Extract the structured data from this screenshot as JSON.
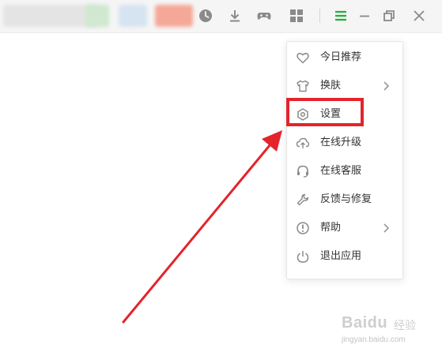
{
  "titlebar": {
    "icons": [
      "history-icon",
      "download-icon",
      "game-icon",
      "apps-icon",
      "menu-icon",
      "minimize-icon",
      "restore-icon",
      "close-icon"
    ],
    "menu_active_color": "#1fb03a"
  },
  "menu": {
    "items": [
      {
        "label": "今日推荐",
        "icon": "heart-icon",
        "has_submenu": false
      },
      {
        "label": "换肤",
        "icon": "shirt-icon",
        "has_submenu": true
      },
      {
        "label": "设置",
        "icon": "settings-icon",
        "has_submenu": false,
        "highlighted": true
      },
      {
        "label": "在线升级",
        "icon": "cloud-upload-icon",
        "has_submenu": false
      },
      {
        "label": "在线客服",
        "icon": "headset-icon",
        "has_submenu": false
      },
      {
        "label": "反馈与修复",
        "icon": "wrench-icon",
        "has_submenu": false
      },
      {
        "label": "帮助",
        "icon": "help-icon",
        "has_submenu": true
      },
      {
        "label": "退出应用",
        "icon": "power-icon",
        "has_submenu": false
      }
    ]
  },
  "annotation": {
    "highlight_color": "#e3242b",
    "points_to": "设置"
  },
  "watermark": {
    "brand": "Baidu",
    "brand_cn": "经验",
    "url": "jingyan.baidu.com"
  }
}
